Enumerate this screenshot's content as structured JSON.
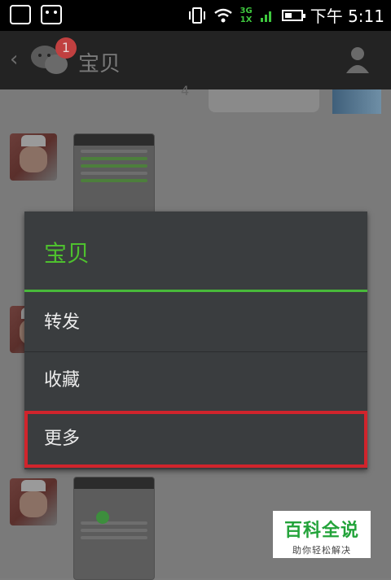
{
  "status_bar": {
    "network": "3G\n1X",
    "time": "下午 5:11"
  },
  "header": {
    "back_icon": "chevron-left-icon",
    "app_icon": "wechat-icon",
    "badge_count": "1",
    "title": "宝贝",
    "profile_icon": "person-icon"
  },
  "chat": {
    "unread_number": "4"
  },
  "menu": {
    "title": "宝贝",
    "items": [
      {
        "label": "转发"
      },
      {
        "label": "收藏"
      },
      {
        "label": "更多"
      }
    ],
    "accent": "#4ec12e",
    "highlight": "#d0242c"
  },
  "watermark": {
    "title": "百科全说",
    "subtitle": "助你轻松解决"
  }
}
